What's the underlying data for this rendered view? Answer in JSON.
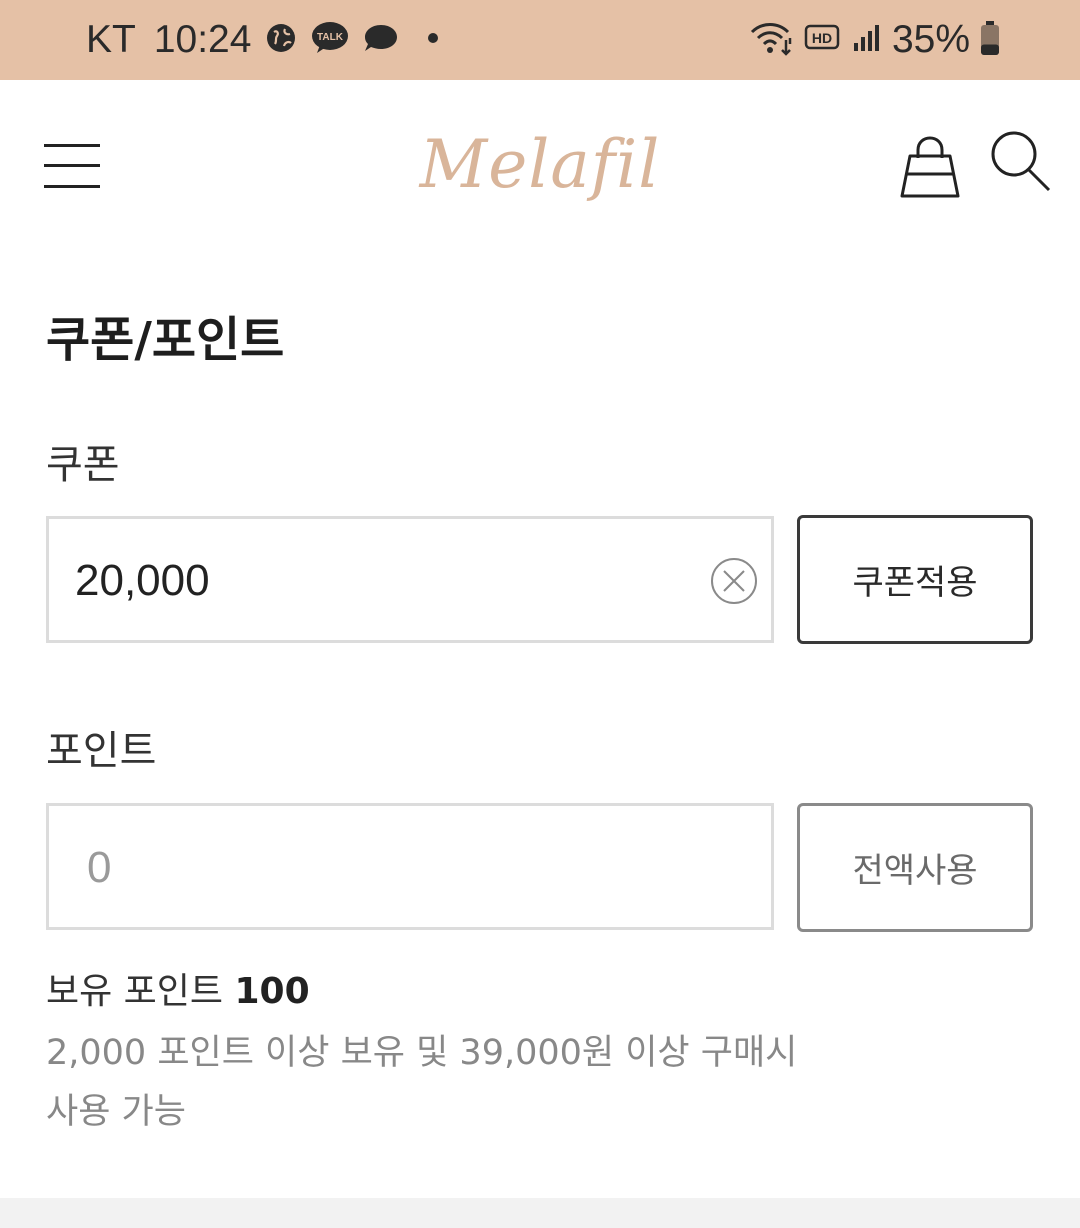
{
  "status_bar": {
    "carrier": "KT",
    "time": "10:24",
    "battery_percent": "35%",
    "battery_level": 0.35,
    "left_icons": [
      "globe-icon",
      "kakaotalk-icon",
      "chat-bubble-icon",
      "notification-dot-icon"
    ],
    "kakaotalk_text": "TALK",
    "right_icons": [
      "wifi-icon",
      "hd-voice-icon",
      "signal-icon",
      "battery-icon"
    ],
    "hd_text": "HD"
  },
  "header": {
    "logo": "Melafil",
    "logo_color": "#d9b59a",
    "icons": [
      "menu-icon",
      "shopping-bag-icon",
      "search-icon"
    ]
  },
  "page": {
    "title": "쿠폰/포인트"
  },
  "coupon": {
    "label": "쿠폰",
    "value": "20,000",
    "apply_button": "쿠폰적용"
  },
  "points": {
    "label": "포인트",
    "placeholder": "0",
    "use_all_button": "전액사용",
    "owned_label": "보유 포인트",
    "owned_value": "100",
    "notice_line1": "2,000 포인트 이상 보유 및 39,000원 이상 구매시",
    "notice_line2": "사용 가능"
  },
  "colors": {
    "status_bar_bg": "#e5c1a6",
    "accent": "#d9b59a"
  }
}
